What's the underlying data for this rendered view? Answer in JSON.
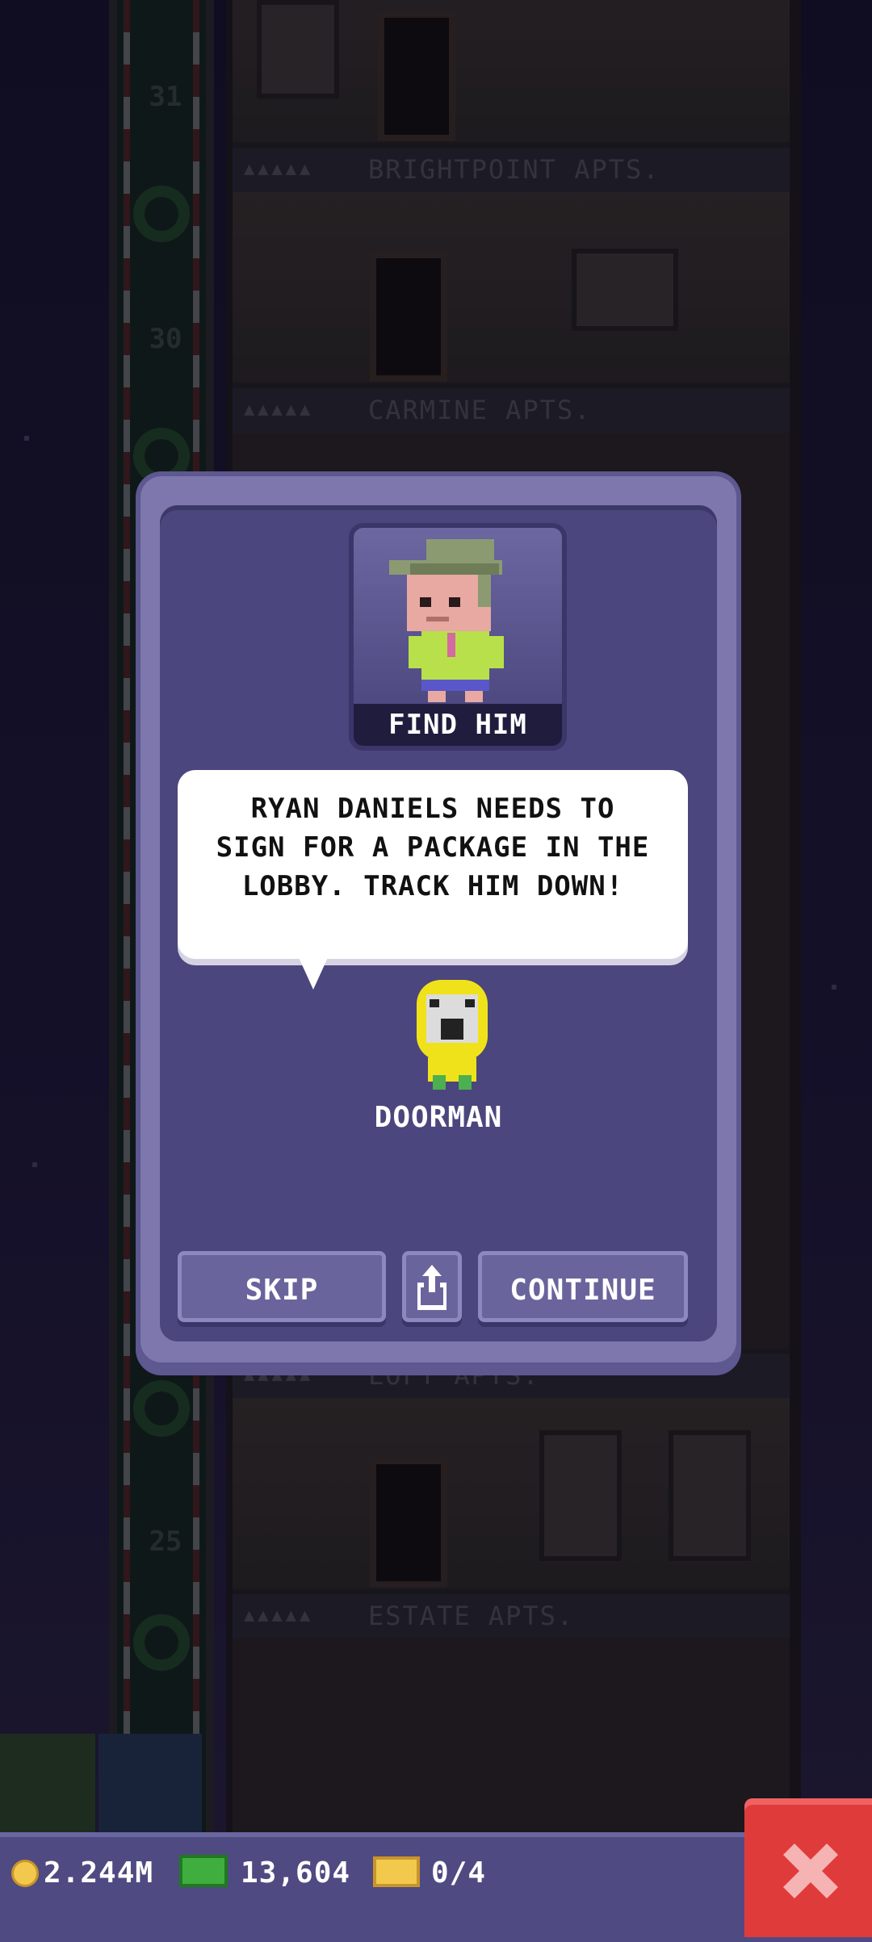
{
  "hud": {
    "coins": "2.244M",
    "bux": "13,604",
    "tickets": "0/4"
  },
  "tower": {
    "floor_numbers": [
      "31",
      "30",
      "25"
    ],
    "floors": [
      {
        "dots": "▲▲▲▲▲",
        "name": "BRIGHTPOINT APTS."
      },
      {
        "dots": "▲▲▲▲▲",
        "name": "CARMINE APTS."
      },
      {
        "dots": "▲▲▲▲▲",
        "name": "LOFT APTS."
      },
      {
        "dots": "▲▲▲▲▲",
        "name": "ESTATE APTS."
      }
    ]
  },
  "dialog": {
    "portrait_label": "FIND HIM",
    "message": "RYAN DANIELS NEEDS TO SIGN FOR A PACKAGE IN THE LOBBY. TRACK HIM DOWN!",
    "speaker": "DOORMAN",
    "buttons": {
      "skip": "SKIP",
      "share_icon": "share-icon",
      "continue": "CONTINUE"
    }
  },
  "colors": {
    "dialog_bg": "#4b467d",
    "dialog_border": "#7d77ae",
    "close_red": "#e03b3b",
    "bar_bg": "#4f4a82"
  }
}
